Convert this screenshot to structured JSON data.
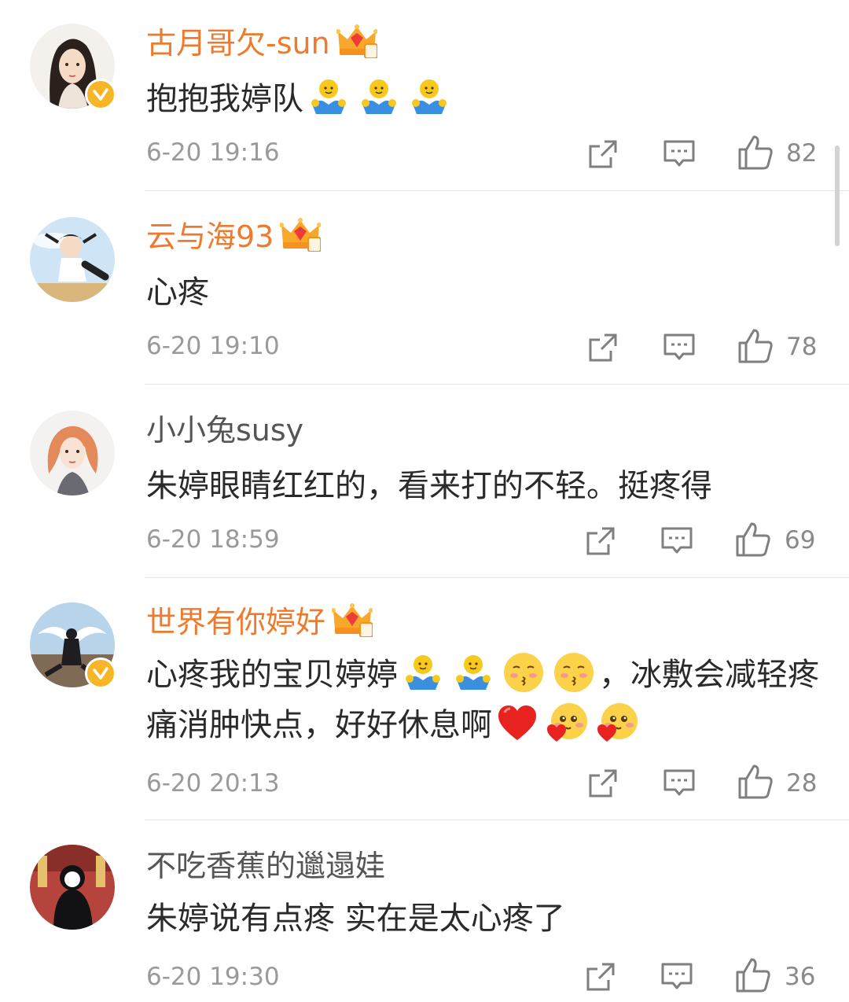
{
  "comments": [
    {
      "username": "古月哥欠-sun",
      "vip_level": "5",
      "verified": true,
      "text_segments": [
        "抱抱我婷队"
      ],
      "trailing_emojis": [
        "hug-emoji",
        "hug-emoji",
        "hug-emoji"
      ],
      "timestamp": "6-20 19:16",
      "likes": "82"
    },
    {
      "username": "云与海93",
      "vip_level": "6",
      "verified": false,
      "text_segments": [
        "心疼"
      ],
      "timestamp": "6-20 19:10",
      "likes": "78"
    },
    {
      "username": "小小兔susy",
      "vip_level": null,
      "verified": false,
      "text_segments": [
        "朱婷眼睛红红的，看来打的不轻。挺疼得"
      ],
      "timestamp": "6-20 18:59",
      "likes": "69"
    },
    {
      "username": "世界有你婷好",
      "vip_level": "6",
      "verified": true,
      "text_segments": [
        "心疼我的宝贝婷婷",
        "，冰敷会减轻疼痛消肿快点，好好休息啊"
      ],
      "emojis_between": [
        "hug-emoji",
        "hug-emoji",
        "kiss-emoji",
        "kiss-emoji"
      ],
      "emojis_end": [
        "red-heart-emoji",
        "blush-heart-emoji",
        "blush-heart-emoji"
      ],
      "timestamp": "6-20 20:13",
      "likes": "28"
    },
    {
      "username": "不吃香蕉的邋遢娃",
      "vip_level": null,
      "verified": false,
      "text_segments": [
        "朱婷说有点疼 实在是太心疼了"
      ],
      "timestamp": "6-20 19:30",
      "likes": "36"
    }
  ],
  "actions": [
    "share-icon",
    "comment-icon",
    "like-icon"
  ],
  "colors": {
    "vip_name": "#ee7a2d",
    "name": "#555555",
    "text": "#2a2a2a",
    "meta": "#9a9a9a",
    "verified_badge": "#f6b628"
  }
}
